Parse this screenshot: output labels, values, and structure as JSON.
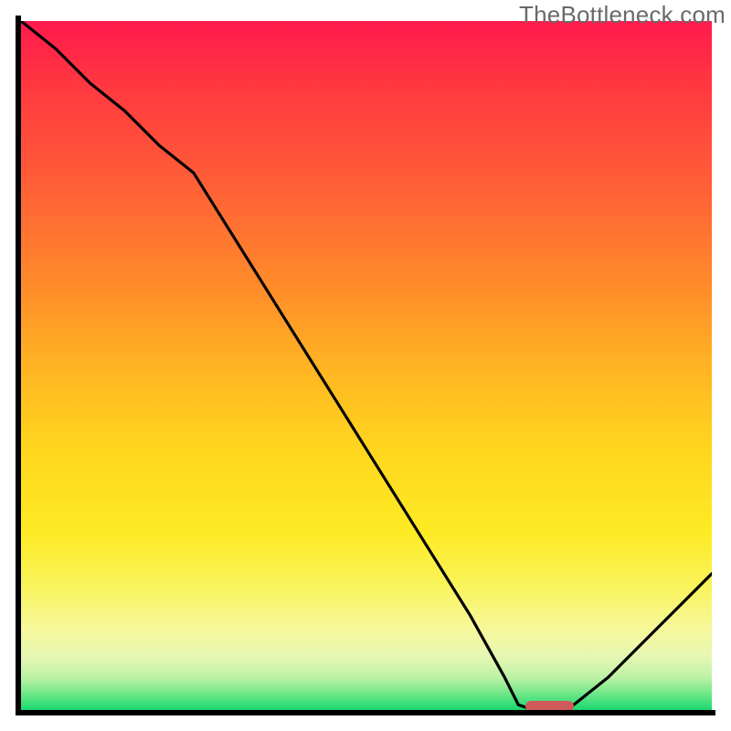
{
  "watermark": "TheBottleneck.com",
  "chart_data": {
    "type": "line",
    "title": "",
    "xlabel": "",
    "ylabel": "",
    "x": [
      0,
      5,
      10,
      15,
      20,
      25,
      30,
      35,
      40,
      45,
      50,
      55,
      60,
      65,
      70,
      72,
      75,
      78,
      80,
      85,
      90,
      95,
      100
    ],
    "values": [
      100,
      96,
      91,
      87,
      82,
      78,
      70,
      62,
      54,
      46,
      38,
      30,
      22,
      14,
      5,
      1,
      0,
      0,
      1,
      5,
      10,
      15,
      20
    ],
    "xlim": [
      0,
      100
    ],
    "ylim": [
      0,
      100
    ],
    "optimum_marker": {
      "x_start": 73,
      "x_end": 80,
      "y": 0
    }
  },
  "colors": {
    "curve": "#000000",
    "marker": "#d05a5a",
    "axis": "#000000"
  }
}
